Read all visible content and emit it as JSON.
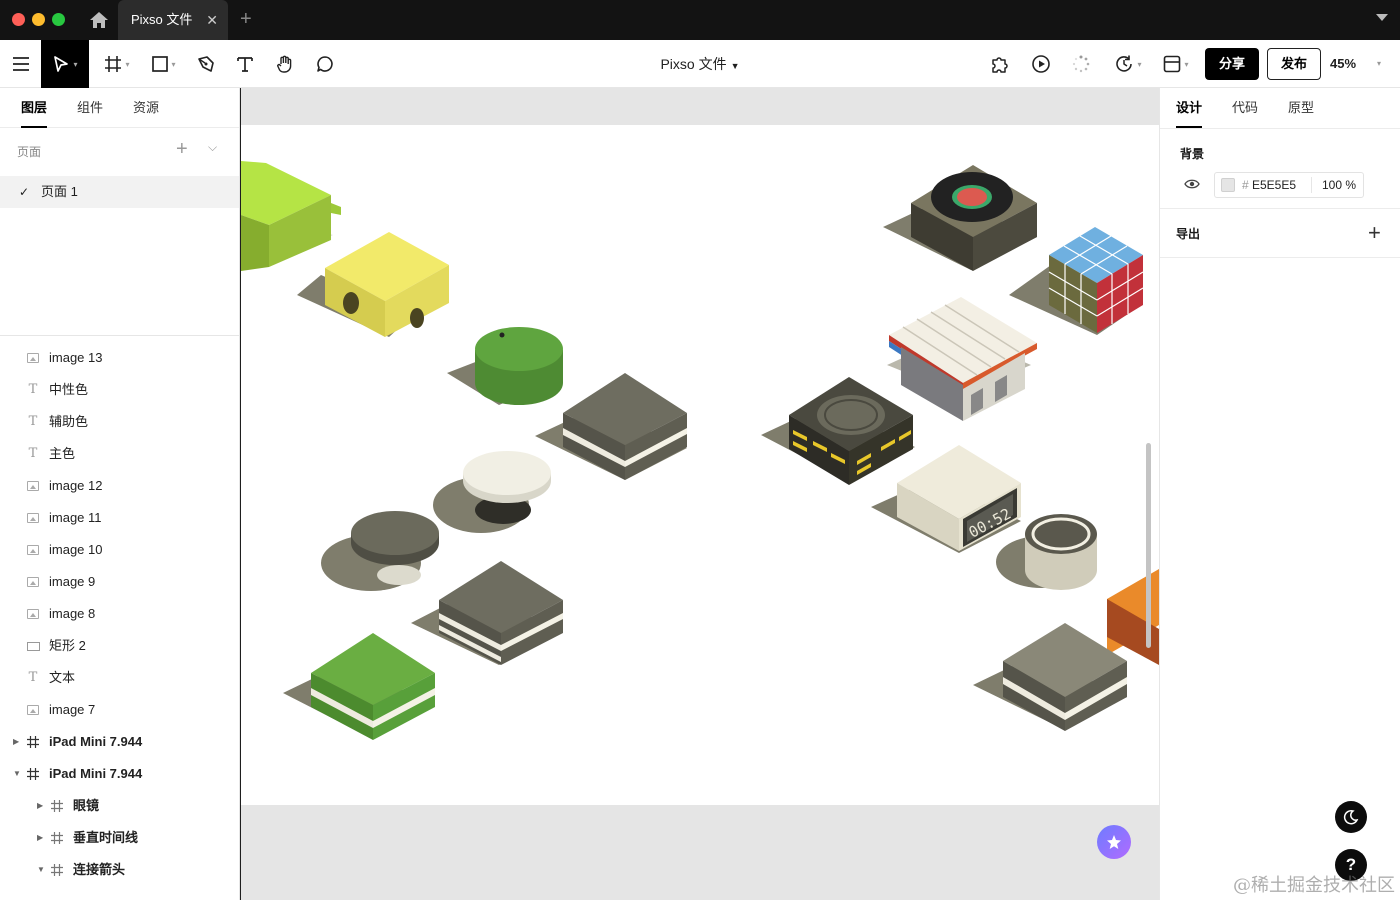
{
  "window": {
    "tab_title": "Pixso 文件",
    "tab_close": "✕",
    "new_tab": "+"
  },
  "toolbar": {
    "file_title": "Pixso 文件",
    "share_label": "分享",
    "publish_label": "发布",
    "zoom": "45%"
  },
  "left_panel": {
    "tabs": [
      "图层",
      "组件",
      "资源"
    ],
    "pages_label": "页面",
    "pages": [
      {
        "name": "页面 1",
        "selected": true
      }
    ],
    "layers": [
      {
        "type": "image",
        "name": "image 13"
      },
      {
        "type": "text",
        "name": "中性色"
      },
      {
        "type": "text",
        "name": "辅助色"
      },
      {
        "type": "text",
        "name": "主色"
      },
      {
        "type": "image",
        "name": "image 12"
      },
      {
        "type": "image",
        "name": "image 11"
      },
      {
        "type": "image",
        "name": "image 10"
      },
      {
        "type": "image",
        "name": "image 9"
      },
      {
        "type": "image",
        "name": "image 8"
      },
      {
        "type": "rect",
        "name": "矩形 2"
      },
      {
        "type": "text",
        "name": "文本"
      },
      {
        "type": "image",
        "name": "image 7"
      },
      {
        "type": "frame",
        "name": "iPad Mini 7.944",
        "expanded": false
      },
      {
        "type": "frame",
        "name": "iPad Mini 7.944",
        "expanded": true
      },
      {
        "type": "frame",
        "name": "眼镜",
        "expanded": false,
        "child": true
      },
      {
        "type": "frame",
        "name": "垂直时间线",
        "expanded": false,
        "child": true
      },
      {
        "type": "frame",
        "name": "连接箭头",
        "expanded": true,
        "child": true
      }
    ]
  },
  "right_panel": {
    "tabs": [
      "设计",
      "代码",
      "原型"
    ],
    "background_title": "背景",
    "background_hash": "#",
    "background_hex": "E5E5E5",
    "background_opacity": "100 %",
    "export_title": "导出"
  },
  "canvas": {
    "clock_text": "00:52",
    "background_color": "#E5E5E5"
  },
  "watermark": "@稀土掘金技术社区",
  "colors": {
    "accent": "#000000",
    "canvas_bg": "#e5e5e5",
    "olive": "#6b6a5c",
    "cream": "#eeece0",
    "green": "#5da43e",
    "yellow": "#ece369"
  },
  "icons": [
    "home-icon",
    "menu-icon",
    "move-tool-icon",
    "frame-tool-icon",
    "shape-tool-icon",
    "pen-tool-icon",
    "text-tool-icon",
    "hand-tool-icon",
    "comment-tool-icon",
    "plugin-icon",
    "play-icon",
    "loading-icon",
    "history-icon",
    "layout-icon",
    "eye-icon",
    "plus-icon",
    "moon-icon",
    "help-icon"
  ]
}
